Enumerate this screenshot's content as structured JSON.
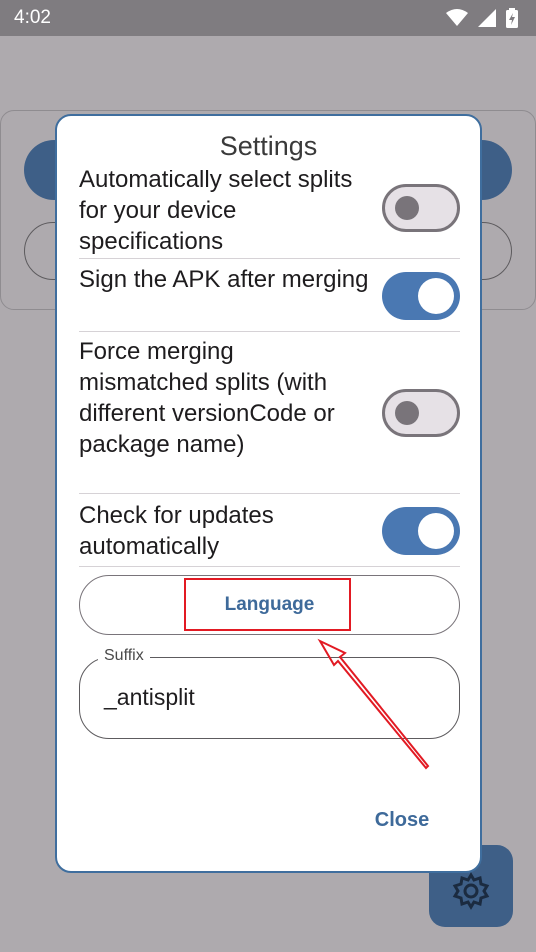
{
  "status_bar": {
    "time": "4:02",
    "icons": [
      "wifi-icon",
      "signal-icon",
      "battery-charging-icon"
    ]
  },
  "dialog": {
    "title": "Settings",
    "options": [
      {
        "label": "Automatically select splits for your device specifications",
        "enabled": false
      },
      {
        "label": "Sign the APK after merging",
        "enabled": true
      },
      {
        "label": "Force merging mismatched splits (with different versionCode or package name)",
        "enabled": false
      },
      {
        "label": "Check for updates automatically",
        "enabled": true
      }
    ],
    "language_button": "Language",
    "suffix_field": {
      "label": "Suffix",
      "value": "_antisplit"
    },
    "close_button": "Close"
  },
  "background": {
    "fab_icon": "gear-icon"
  },
  "colors": {
    "accent": "#4a78b2",
    "accent_text": "#3e6a9a",
    "annotation": "#e21a23",
    "scrim": "#aeaaae"
  }
}
